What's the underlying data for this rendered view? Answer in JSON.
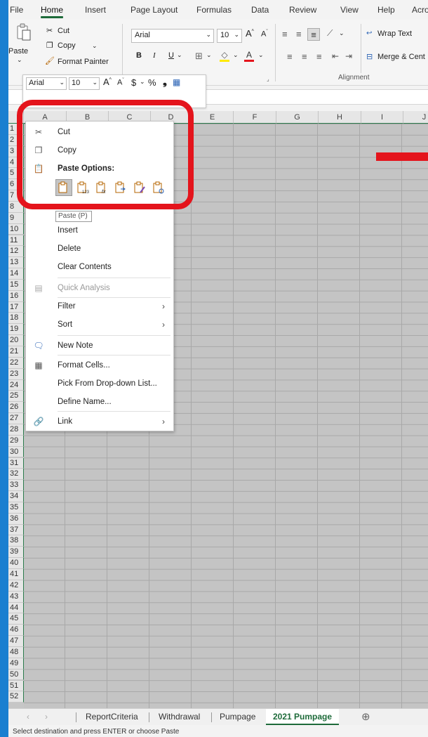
{
  "ribbon_tabs": [
    "File",
    "Home",
    "Insert",
    "Page Layout",
    "Formulas",
    "Data",
    "Review",
    "View",
    "Help",
    "Acro"
  ],
  "clipboard": {
    "cut": "Cut",
    "copy": "Copy",
    "paste": "Paste",
    "format_painter": "Format Painter"
  },
  "font": {
    "name": "Arial",
    "size": "10"
  },
  "alignment": {
    "wrap_text": "Wrap Text",
    "merge": "Merge & Cent",
    "group_label": "Alignment"
  },
  "mini_toolbar": {
    "font": "Arial",
    "size": "10",
    "currency": "$",
    "percent": "%"
  },
  "columns": [
    "A",
    "B",
    "C",
    "D",
    "E",
    "F",
    "G",
    "H",
    "I",
    "J"
  ],
  "rows": [
    "1",
    "2",
    "3",
    "4",
    "5",
    "6",
    "7",
    "8",
    "9",
    "10",
    "11",
    "12",
    "13",
    "14",
    "15",
    "16",
    "17",
    "18",
    "19",
    "20",
    "21",
    "22",
    "23",
    "24",
    "25",
    "26",
    "27",
    "28",
    "29",
    "30",
    "31",
    "32",
    "33",
    "34",
    "35",
    "36",
    "37",
    "38",
    "39",
    "40",
    "41",
    "42",
    "43",
    "44",
    "45",
    "46",
    "47",
    "48",
    "49",
    "50",
    "51",
    "52"
  ],
  "context_menu": {
    "cut": "Cut",
    "copy": "Copy",
    "paste_options": "Paste Options:",
    "insert": "Insert",
    "delete": "Delete",
    "clear_contents": "Clear Contents",
    "quick_analysis": "Quick Analysis",
    "filter": "Filter",
    "sort": "Sort",
    "new_note": "New Note",
    "format_cells": "Format Cells...",
    "pick_dropdown": "Pick From Drop-down List...",
    "define_name": "Define Name...",
    "link": "Link"
  },
  "paste_tooltip": "Paste (P)",
  "sheet_tabs": [
    "ReportCriteria",
    "Withdrawal",
    "Pumpage",
    "2021 Pumpage"
  ],
  "active_sheet": "2021 Pumpage",
  "status": "Select destination and press ENTER or choose Paste",
  "colors": {
    "highlight": "#e4141c",
    "excel_green": "#1e6b3a",
    "background": "#1a7fd0"
  }
}
